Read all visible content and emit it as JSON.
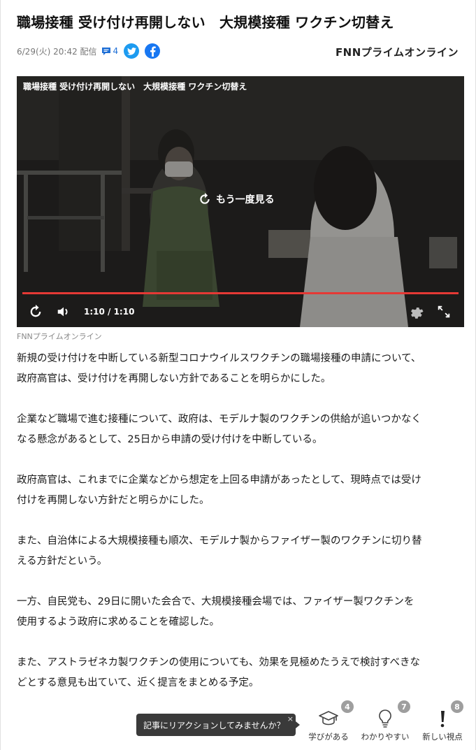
{
  "article": {
    "title": "職場接種 受け付け再開しない　大規模接種 ワクチン切替え",
    "date": "6/29(火) 20:42 配信",
    "comment_count": "4",
    "brand": "FNNプライムオンライン"
  },
  "video": {
    "title": "職場接種 受け付け再開しない　大規模接種 ワクチン切替え",
    "replay_label": "もう一度見る",
    "time": "1:10 / 1:10",
    "progress_fraction": 1.0
  },
  "caption": "FNNプライムオンライン",
  "paragraphs": [
    "新規の受け付けを中断している新型コロナウイルスワクチンの職場接種の申請について、\n政府高官は、受け付けを再開しない方針であることを明らかにした。",
    "企業など職場で進む接種について、政府は、モデルナ製のワクチンの供給が追いつかなく\nなる懸念があるとして、25日から申請の受け付けを中断している。",
    "政府高官は、これまでに企業などから想定を上回る申請があったとして、現時点では受け\n付けを再開しない方針だと明らかにした。",
    "また、自治体による大規模接種も順次、モデルナ製からファイザー製のワクチンに切り替\nえる方針だという。",
    "一方、自民党も、29日に開いた会合で、大規模接種会場では、ファイザー製ワクチンを\n使用するよう政府に求めることを確認した。",
    "また、アストラゼネカ製ワクチンの使用についても、効果を見極めたうえで検討すべきな\nどとする意見も出ていて、近く提言をまとめる予定。"
  ],
  "reaction_prompt": {
    "text": "記事にリアクションしてみませんか？",
    "close": "×"
  },
  "reactions": [
    {
      "label": "学びがある",
      "count": "4",
      "icon": "graduation-cap-icon"
    },
    {
      "label": "わかりやすい",
      "count": "7",
      "icon": "lightbulb-icon"
    },
    {
      "label": "新しい視点",
      "count": "8",
      "icon": "exclamation-icon"
    }
  ],
  "colors": {
    "accent_blue": "#1f6fd6",
    "twitter": "#1d9bf0",
    "facebook": "#1877f2",
    "progress_red": "#e53935",
    "badge_gray": "#9e9e9e"
  }
}
